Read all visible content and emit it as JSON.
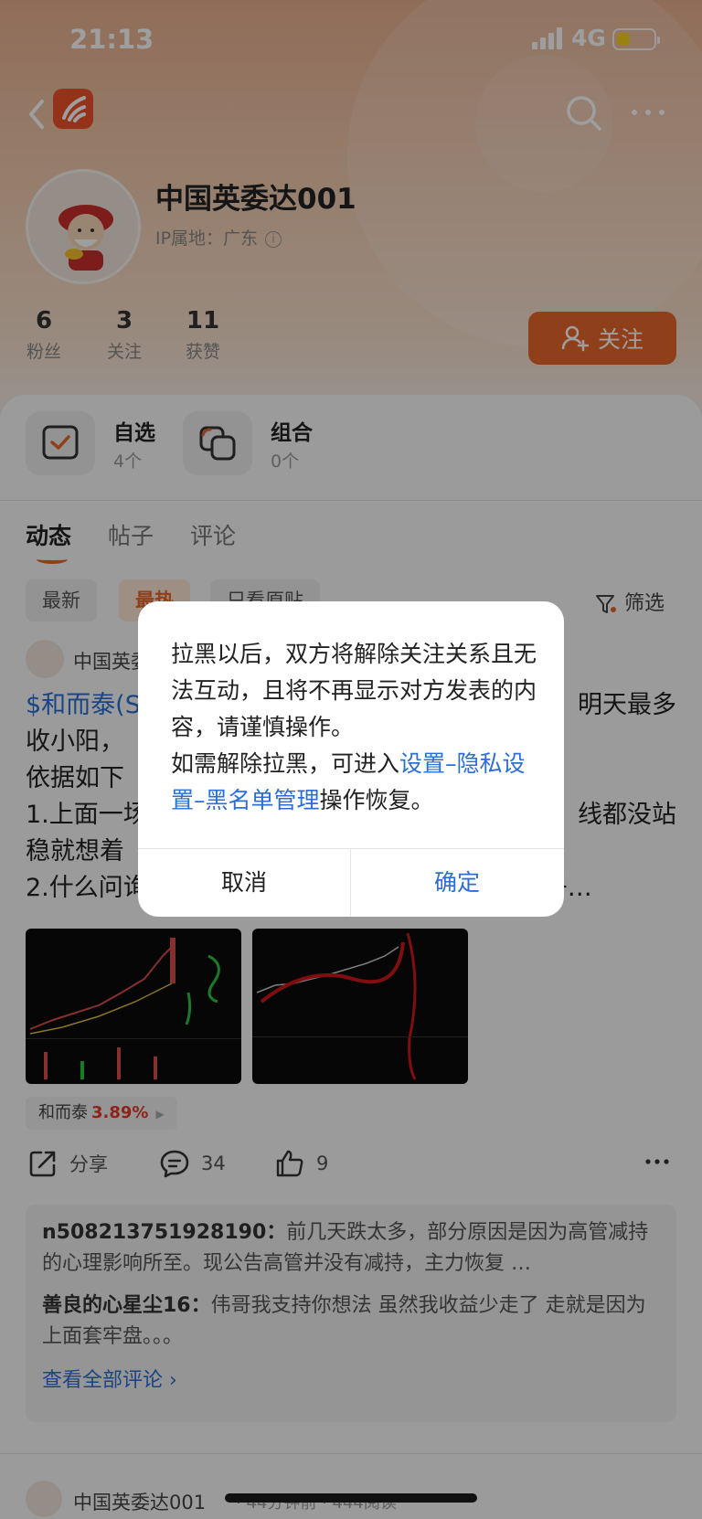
{
  "status_bar": {
    "time": "21:13",
    "network": "4G"
  },
  "profile": {
    "name": "中国英委达001",
    "ip_label": "IP属地：广东",
    "stats": [
      {
        "value": "6",
        "label": "粉丝"
      },
      {
        "value": "3",
        "label": "关注"
      },
      {
        "value": "11",
        "label": "获赞"
      }
    ],
    "follow_label": "关注"
  },
  "quick_cards": [
    {
      "title": "自选",
      "sub": "4个"
    },
    {
      "title": "组合",
      "sub": "0个"
    }
  ],
  "tabs": [
    "动态",
    "帖子",
    "评论"
  ],
  "filters": {
    "chips": [
      "最新",
      "最热",
      "只看原贴"
    ],
    "filter_label": "筛选"
  },
  "post": {
    "author": "中国英委达001",
    "line1_stock": "$和而泰(S",
    "line1_rest": "明天最多",
    "line2": "收小阳，",
    "line3": "依据如下",
    "line4a": "1.上面一场",
    "line4b": "线都没站",
    "line5": "稳就想着",
    "line6": "2.什么问询回复，这个只是一个流程。就像你儿子…",
    "tag_name": "和而泰",
    "tag_pct": "3.89%",
    "share_label": "分享",
    "comment_count": "34",
    "like_count": "9",
    "comments": [
      {
        "user": "n508213751928190：",
        "text": "前几天跌太多，部分原因是因为高管减持的心理影响所至。现公告高管并没有减持，主力恢复 …"
      },
      {
        "user": "善良的心星尘16：",
        "text": "伟哥我支持你想法 虽然我收益少走了 走就是因为上面套牢盘。。。"
      }
    ],
    "view_all": "查看全部评论 ›"
  },
  "post2": {
    "author": "中国英委达001",
    "meta": "· 44分钟前 · 444阅读"
  },
  "dialog": {
    "message_part1": "拉黑以后，双方将解除关注关系且无法互动，且将不再显示对方发表的内容，请谨慎操作。",
    "message_part2": "如需解除拉黑，可进入",
    "message_link": "设置–隐私设置–黑名单管理",
    "message_part3": "操作恢复。",
    "cancel": "取消",
    "confirm": "确定"
  },
  "colors": {
    "accent": "#e8672c",
    "link": "#2b6fd6",
    "up": "#e23b2e"
  }
}
